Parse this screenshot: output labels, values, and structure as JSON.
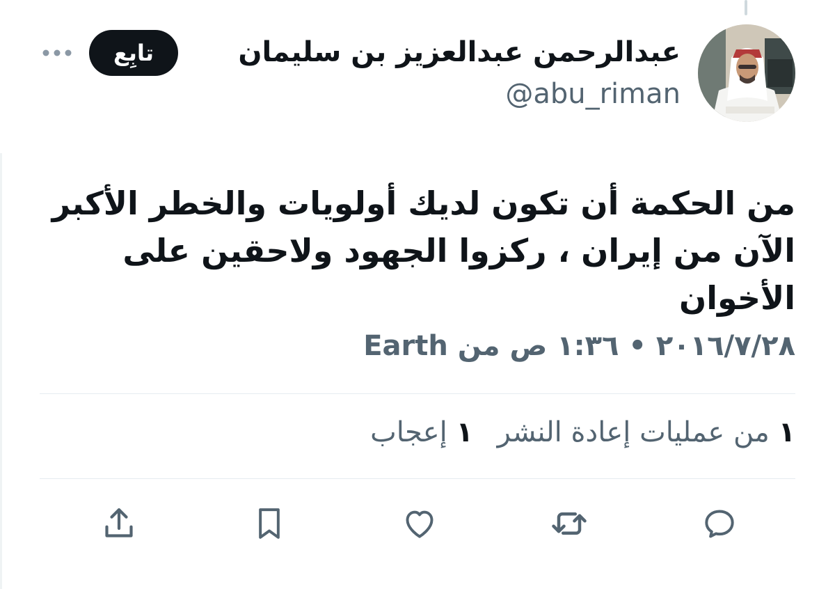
{
  "author": {
    "display_name": "عبدالرحمن عبدالعزيز بن سليمان",
    "handle": "@abu_riman"
  },
  "follow_label": "تابِع",
  "tweet": {
    "line1": "من الحكمة أن تكون لديك أولويات والخطر الأكبر",
    "line2": "الآن من إيران ، ركزوا الجهود ولاحقين على الأخوان"
  },
  "meta": {
    "text": "٢٠١٦/٧/٢٨ • ١:٣٦ ص من",
    "source": "Earth"
  },
  "stats": {
    "retweets_count": "١",
    "retweets_label": "من عمليات إعادة النشر",
    "likes_count": "١",
    "likes_label": "إعجاب"
  },
  "actions": {
    "reply": "reply-icon",
    "retweet": "retweet-icon",
    "like": "heart-icon",
    "bookmark": "bookmark-icon",
    "share": "share-icon"
  },
  "colors": {
    "text_primary": "#0f1419",
    "text_secondary": "#536471",
    "divider": "#e6ecf0",
    "button_bg": "#0f1419"
  }
}
